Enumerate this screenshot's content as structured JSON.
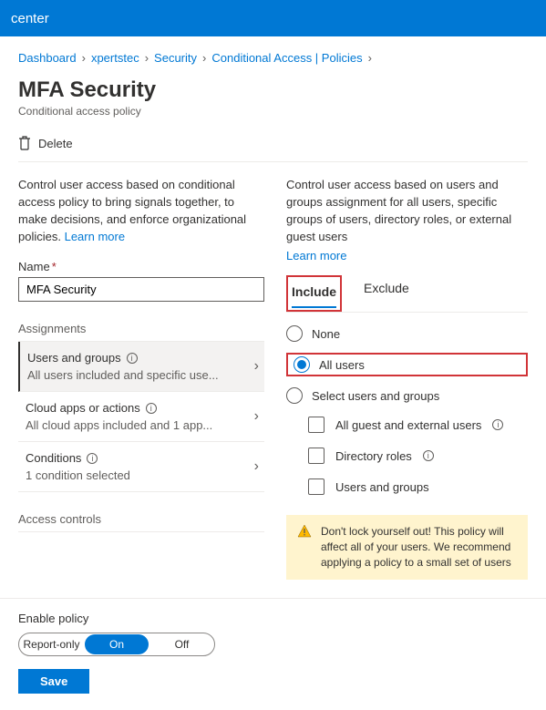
{
  "topbar": {
    "title": "center"
  },
  "breadcrumb": [
    "Dashboard",
    "xpertstec",
    "Security",
    "Conditional Access | Policies"
  ],
  "page": {
    "title": "MFA Security",
    "subtitle": "Conditional access policy"
  },
  "toolbar": {
    "delete_label": "Delete"
  },
  "left": {
    "desc": "Control user access based on conditional access policy to bring signals together, to make decisions, and enforce organizational policies.",
    "learn_more": "Learn more",
    "name_label": "Name",
    "name_value": "MFA Security",
    "section_assignments": "Assignments",
    "items": [
      {
        "title": "Users and groups",
        "value": "All users included and specific use..."
      },
      {
        "title": "Cloud apps or actions",
        "value": "All cloud apps included and 1 app..."
      },
      {
        "title": "Conditions",
        "value": "1 condition selected"
      }
    ],
    "section_access": "Access controls"
  },
  "right": {
    "desc": "Control user access based on users and groups assignment for all users, specific groups of users, directory roles, or external guest users",
    "learn_more": "Learn more",
    "tabs": {
      "include": "Include",
      "exclude": "Exclude",
      "selected": "include"
    },
    "radios": {
      "none": "None",
      "all": "All users",
      "select": "Select users and groups",
      "selected": "all"
    },
    "checks": {
      "guest": "All guest and external users",
      "roles": "Directory roles",
      "groups": "Users and groups"
    },
    "warning": "Don't lock yourself out! This policy will affect all of your users. We recommend applying a policy to a small set of users"
  },
  "bottom": {
    "enable_label": "Enable policy",
    "report_only": "Report-only",
    "on": "On",
    "off": "Off",
    "save": "Save"
  }
}
